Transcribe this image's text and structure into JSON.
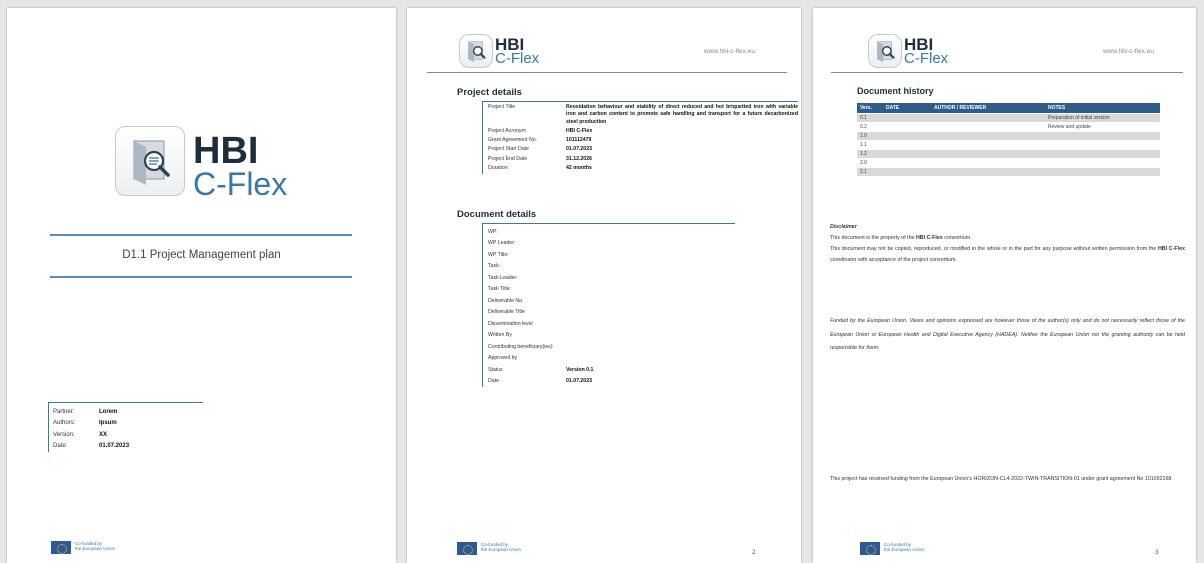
{
  "brand": {
    "hbi": "HBI",
    "cflex": "C-Flex",
    "url": "www.hbi-c-flex.eu"
  },
  "colors": {
    "accent": "#3a78a8",
    "table_header": "#2f5d8a",
    "eu_blue": "#2d5a96"
  },
  "eu": {
    "line1": "Co-funded by",
    "line2": "the European Union"
  },
  "page1": {
    "doc_title": "D1.1 Project Management plan",
    "info": [
      {
        "k": "Partner:",
        "v": "Lorem"
      },
      {
        "k": "Authors:",
        "v": "Ipsum"
      },
      {
        "k": "Version:",
        "v": "XX"
      },
      {
        "k": "Date:",
        "v": "01.07.2023"
      }
    ]
  },
  "page2": {
    "project_title": "Project details",
    "project": [
      {
        "k": "Project Title",
        "v": "Reoxidation behaviour and stability of direct reduced and hot briquetted iron with variable iron and carbon content to promote safe handling and transport for a future decarbonized steel production"
      },
      {
        "k": "Project Acronym",
        "v": "HBI C-Flex"
      },
      {
        "k": "Grant Agreement No.",
        "v": "101112479"
      },
      {
        "k": "Project Start Date",
        "v": "01.07.2023"
      },
      {
        "k": "Project End Date",
        "v": "31.12.2026"
      },
      {
        "k": "Duration",
        "v": "42 months"
      }
    ],
    "document_title": "Document details",
    "document": [
      {
        "k": "WP:",
        "v": ""
      },
      {
        "k": "WP Leader:",
        "v": ""
      },
      {
        "k": "WP Title:",
        "v": ""
      },
      {
        "k": "Task:",
        "v": ""
      },
      {
        "k": "Task Leader:",
        "v": ""
      },
      {
        "k": "Task Title:",
        "v": ""
      },
      {
        "k": "Deliverable No.",
        "v": ""
      },
      {
        "k": "Deliverable Title",
        "v": ""
      },
      {
        "k": "Dissemination level",
        "v": ""
      },
      {
        "k": "Written By",
        "v": ""
      },
      {
        "k": "Contributing beneficiary(ies)",
        "v": ""
      },
      {
        "k": "Approved by",
        "v": ""
      },
      {
        "k": "Status",
        "v": "Version 0.1"
      },
      {
        "k": "Date",
        "v": "01.07.2023"
      }
    ],
    "page_number": "2"
  },
  "page3": {
    "history_title": "Document history",
    "headers": [
      "Vers.",
      "DATE",
      "AUTHOR / REVIEWER",
      "NOTES"
    ],
    "rows": [
      [
        "0.1",
        "",
        "",
        "Preparation of initial version"
      ],
      [
        "0.2",
        "",
        "",
        "Review and update"
      ],
      [
        "1.0",
        "",
        "",
        ""
      ],
      [
        "1.1",
        "",
        "",
        ""
      ],
      [
        "1.2",
        "",
        "",
        ""
      ],
      [
        "2.0",
        "",
        "",
        ""
      ],
      [
        "2.1",
        "",
        "",
        ""
      ]
    ],
    "disclaimer_title": "Disclaimer",
    "disclaimer_1a": "This document is the property of the ",
    "disclaimer_1b": "HBI C-Flex",
    "disclaimer_1c": " consortium.",
    "disclaimer_2a": "This document may not be copied, reproduced, or modified in the whole or in the part for any purpose without written permission from the ",
    "disclaimer_2b": "HBI C-Flex",
    "disclaimer_2c": " coordinator with acceptance of the project consortium.",
    "funded_text": "Funded by the European Union. Views and opinions expressed are however those of the author(s) only and do not necessarily reflect those of the European Union or European Health and Digital Executive Agency (HADEA). Neither the European Union nor the granting authority can be held responsible for them.",
    "funding_text": "This project has received funding from the European Union's HORIZON-CL4-2022-TWIN-TRANSITION-01 under grant agreement No 101092168.",
    "page_number": "3"
  }
}
